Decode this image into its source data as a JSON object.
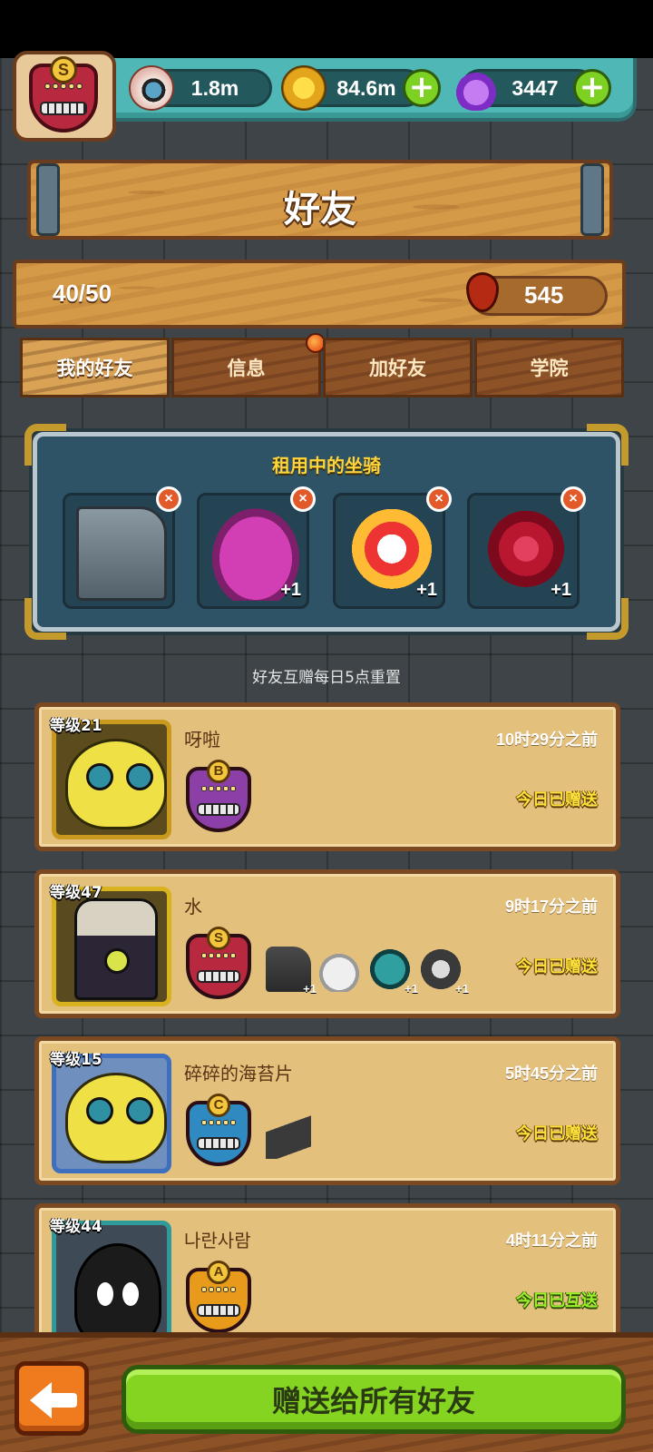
{
  "resources": {
    "eyes": "1.8m",
    "coins": "84.6m",
    "potions": "3447"
  },
  "player": {
    "rank": "S"
  },
  "header": {
    "title": "好友"
  },
  "friend_count": "40/50",
  "blood": "545",
  "tabs": [
    {
      "label": "我的好友"
    },
    {
      "label": "信息"
    },
    {
      "label": "加好友"
    },
    {
      "label": "学院"
    }
  ],
  "rented_mounts": {
    "title": "租用中的坐骑",
    "slots": [
      {
        "bonus": ""
      },
      {
        "bonus": "+1"
      },
      {
        "bonus": "+1"
      },
      {
        "bonus": "+1"
      }
    ]
  },
  "reset_note": "好友互赠每日5点重置",
  "friends": [
    {
      "level": "等级21",
      "name": "呀啦",
      "time": "10时29分之前",
      "status": "今日已赠送",
      "rank": "B"
    },
    {
      "level": "等级47",
      "name": "水",
      "time": "9时17分之前",
      "status": "今日已赠送",
      "rank": "S",
      "mount_bonus": "+1"
    },
    {
      "level": "等级15",
      "name": "碎碎的海苔片",
      "time": "5时45分之前",
      "status": "今日已赠送",
      "rank": "C"
    },
    {
      "level": "等级44",
      "name": "나란사람",
      "time": "4时11分之前",
      "status": "今日已互送",
      "rank": "A"
    }
  ],
  "footer": {
    "gift_all_label": "赠送给所有好友"
  },
  "colors": {
    "gift_green": "#86d422",
    "status_yellow": "#ffe23a",
    "status_green": "#9cf02c",
    "panel_blue": "#2f5366"
  }
}
